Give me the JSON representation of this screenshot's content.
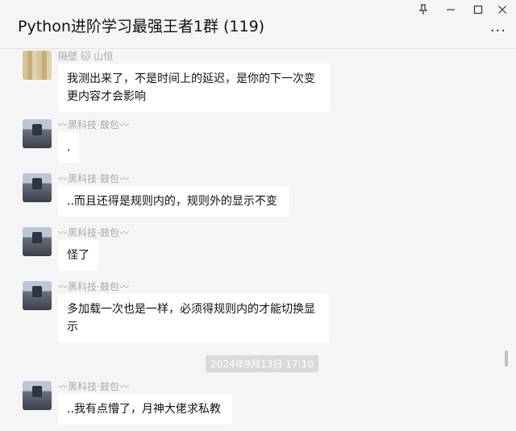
{
  "window": {
    "title": "Python进阶学习最强王者1群 (119)",
    "pin_icon": "pin-icon",
    "minimize_icon": "minimize-icon",
    "maximize_icon": "maximize-icon",
    "close_icon": "close-icon",
    "more_label": "···"
  },
  "messages": [
    {
      "nick": "隔壁 🐱 山恒",
      "text_lines": [
        "我测出来了，不是时间上的延迟，是你的下一次变",
        "更内容才会影响"
      ]
    },
    {
      "nick": "〰黑科技·鼓包〰",
      "text_lines": [
        "."
      ]
    },
    {
      "nick": "〰黑科技·鼓包〰",
      "text_lines": [
        "..而且还得是规则内的，规则外的显示不变"
      ]
    },
    {
      "nick": "〰黑科技·鼓包〰",
      "text_lines": [
        "怪了"
      ]
    },
    {
      "nick": "〰黑科技·鼓包〰",
      "text_lines": [
        "多加载一次也是一样，必须得规则内的才能切换显",
        "示"
      ]
    },
    {
      "nick": "〰黑科技·鼓包〰",
      "text_lines": [
        "..我有点懵了，月神大佬求私教"
      ]
    }
  ],
  "timestamp": "2024年9月13日 17:10"
}
